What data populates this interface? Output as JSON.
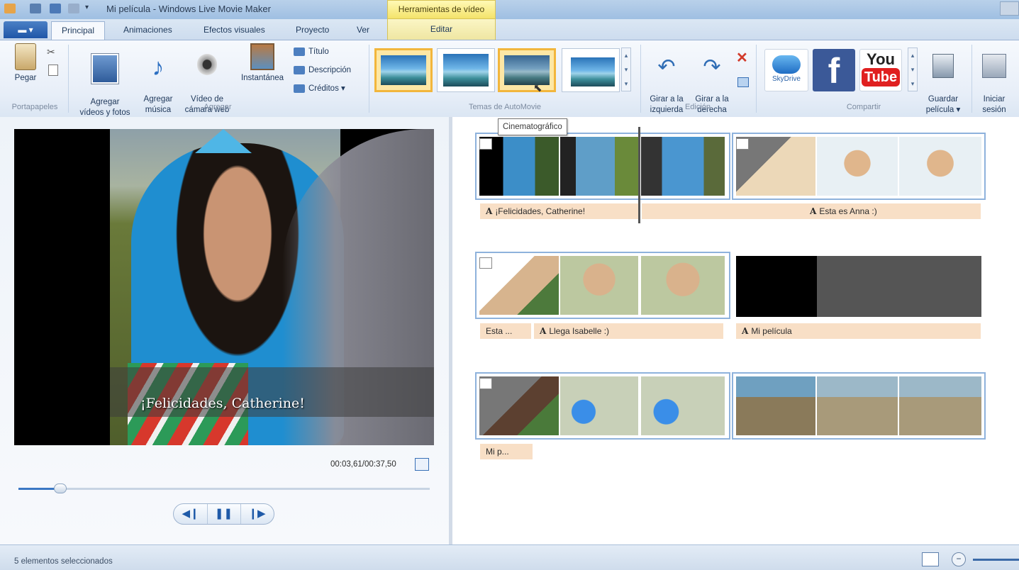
{
  "window": {
    "title": "Mi película - Windows Live Movie Maker",
    "context_tab_group": "Herramientas de vídeo"
  },
  "tabs": [
    "Principal",
    "Animaciones",
    "Efectos visuales",
    "Proyecto",
    "Ver",
    "Editar"
  ],
  "ribbon": {
    "clipboard": {
      "paste": "Pegar",
      "group": "Portapapeles"
    },
    "add": {
      "add_videos": "Agregar\nvídeos y fotos",
      "add_music": "Agregar\nmúsica",
      "webcam": "Vídeo de\ncámara web",
      "snapshot": "Instantánea",
      "title": "Título",
      "caption": "Descripción",
      "credits": "Créditos",
      "group": "Agregar"
    },
    "themes": {
      "group": "Temas de AutoMovie"
    },
    "editing": {
      "rotate_left": "Girar a la\nizquierda",
      "rotate_right": "Girar a la\nderecha",
      "group": "Edición"
    },
    "share": {
      "skydrive": "SkyDrive",
      "youtube_line1": "You",
      "youtube_line2": "Tube",
      "save_movie": "Guardar\npelícula",
      "group": "Compartir"
    },
    "sign_in": "Iniciar\nsesión"
  },
  "tooltip": "Cinematográfico",
  "preview": {
    "caption": "¡Felicidades, Catherine!",
    "time": "00:03,61/00:37,50"
  },
  "storyboard": {
    "captions": {
      "row1_a": "¡Felicidades, Catherine!",
      "row1_b": "Esta es Anna :)",
      "row2_a": "Esta ...",
      "row2_b": "Llega Isabelle :)",
      "row2_c": "Mi película",
      "row3_a": "Mi p..."
    }
  },
  "status": {
    "text": "5 elementos seleccionados"
  },
  "colors": {
    "accent": "#3b78c4",
    "caption_bar": "#f8dfc6",
    "context_tab": "#f4e36a"
  }
}
